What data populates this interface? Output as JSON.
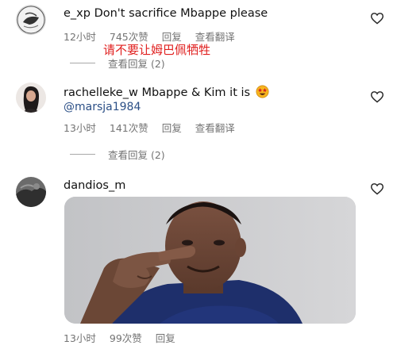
{
  "comments": [
    {
      "username": "e_xp",
      "text": "Don't sacrifice Mbappe please",
      "time": "12小时",
      "likes": "745次赞",
      "reply": "回复",
      "see_translation": "查看翻译",
      "translation_overlay": "请不要让姆巴佩牺牲",
      "view_replies": "查看回复 (2)"
    },
    {
      "username": "rachelleke_w",
      "text": "Mbappe & Kim it is",
      "emoji": "star-struck-emoji",
      "mention": "@marsja1984",
      "time": "13小时",
      "likes": "141次赞",
      "reply": "回复",
      "see_translation": "查看翻译",
      "view_replies": "查看回复 (2)"
    },
    {
      "username": "dandios_m",
      "image": "photo-of-man-pointing",
      "time": "13小时",
      "likes": "99次赞",
      "reply": "回复"
    }
  ],
  "colors": {
    "text": "#111111",
    "meta": "#737373",
    "mention": "#2b4f86",
    "translation": "#e0201f"
  },
  "icons": [
    "heart-outline-icon"
  ]
}
